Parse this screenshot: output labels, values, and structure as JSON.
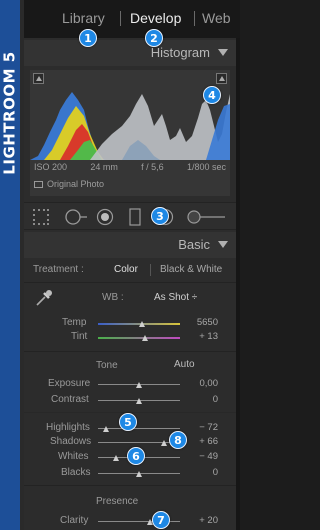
{
  "spine": {
    "label": "LIGHTROOM 5"
  },
  "modules": {
    "library": "Library",
    "develop": "Develop",
    "web": "Web"
  },
  "histogram": {
    "title": "Histogram",
    "iso": "ISO 200",
    "focal": "24 mm",
    "aperture": "f / 5,6",
    "shutter": "1/800 sec",
    "original_photo": "Original Photo"
  },
  "basic": {
    "title": "Basic",
    "treatment_label": "Treatment :",
    "treatment_color": "Color",
    "treatment_bw": "Black & White",
    "wb_label": "WB :",
    "wb_value": "As Shot ÷",
    "temp_label": "Temp",
    "temp_value": "5650",
    "tint_label": "Tint",
    "tint_value": "+ 13",
    "tone_label": "Tone",
    "auto_label": "Auto",
    "exposure_label": "Exposure",
    "exposure_value": "0,00",
    "contrast_label": "Contrast",
    "contrast_value": "0",
    "highlights_label": "Highlights",
    "highlights_value": "− 72",
    "shadows_label": "Shadows",
    "shadows_value": "+ 66",
    "whites_label": "Whites",
    "whites_value": "− 49",
    "blacks_label": "Blacks",
    "blacks_value": "0",
    "presence_label": "Presence",
    "clarity_label": "Clarity",
    "clarity_value": "+ 20"
  },
  "badges": {
    "b1": "1",
    "b2": "2",
    "b3": "3",
    "b4": "4",
    "b5": "5",
    "b6": "6",
    "b7": "7",
    "b8": "8"
  },
  "colors": {
    "accent_blue": "#1e88e5",
    "spine_blue": "#1d4f98",
    "panel": "#2c2c2c"
  },
  "icons": [
    "crop-overlay-icon",
    "spot-removal-icon",
    "red-eye-icon",
    "graduated-filter-icon",
    "radial-filter-icon",
    "adjustment-brush-icon",
    "eyedropper-icon",
    "triangle-collapse-icon",
    "clipping-indicator-icon"
  ]
}
